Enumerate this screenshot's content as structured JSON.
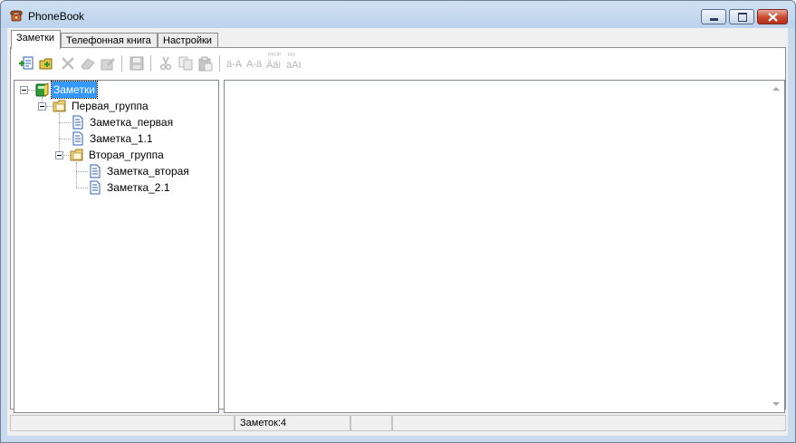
{
  "window": {
    "title": "PhoneBook"
  },
  "tabs": [
    {
      "label": "Заметки",
      "active": true
    },
    {
      "label": "Телефонная книга",
      "active": false
    },
    {
      "label": "Настройки",
      "active": false
    }
  ],
  "toolbar": {
    "buttons": [
      {
        "icon": "new-note-icon",
        "enabled": true
      },
      {
        "icon": "new-folder-icon",
        "enabled": true
      },
      {
        "icon": "delete-icon",
        "enabled": false
      },
      {
        "icon": "eraser-icon",
        "enabled": false
      },
      {
        "icon": "edit-icon",
        "enabled": false
      },
      {
        "icon": "save-icon",
        "enabled": false
      },
      {
        "icon": "cut-icon",
        "enabled": false
      },
      {
        "icon": "copy-icon",
        "enabled": false
      },
      {
        "icon": "paste-icon",
        "enabled": false
      },
      {
        "icon": "font-decrease-icon",
        "enabled": false,
        "text": "ä-A"
      },
      {
        "icon": "font-increase-icon",
        "enabled": false,
        "text": "A-ä"
      },
      {
        "icon": "proportional-font-icon",
        "enabled": false,
        "text": "Ääi",
        "caption": "PROP"
      },
      {
        "icon": "invert-case-icon",
        "enabled": false,
        "text": "aAI",
        "caption": "INV"
      }
    ]
  },
  "tree": {
    "root": {
      "label": "Заметки",
      "icon": "notebook-icon",
      "selected": true
    },
    "groups": [
      {
        "label": "Первая_группа",
        "notes": [
          "Заметка_первая",
          "Заметка_1.1"
        ]
      },
      {
        "label": "Вторая_группа",
        "notes": [
          "Заметка_вторая",
          "Заметка_2.1"
        ]
      }
    ]
  },
  "status": {
    "count_text": "Заметок:4"
  },
  "colors": {
    "selection": "#3399ff",
    "close_button": "#c9462e"
  }
}
